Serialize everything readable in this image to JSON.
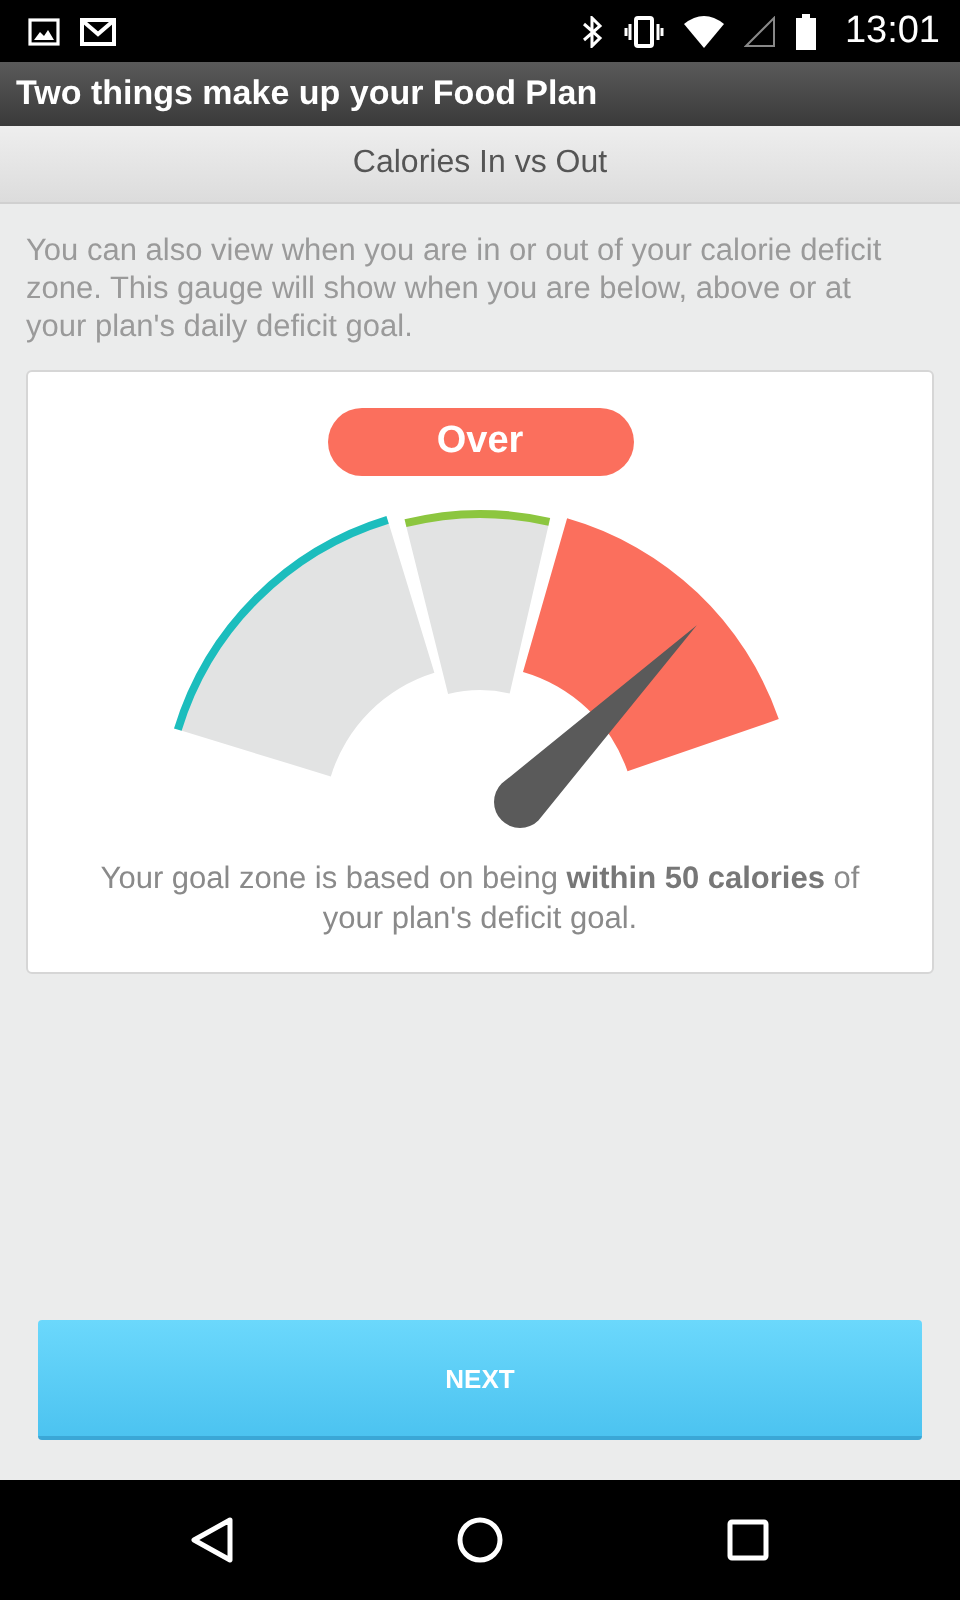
{
  "status_bar": {
    "time": "13:01"
  },
  "header": {
    "title": "Two things make up your Food Plan"
  },
  "subheader": {
    "title": "Calories In vs Out"
  },
  "intro": "You can also view when you are in or out of your calorie deficit zone. This gauge will show when you are below, above or at your plan's daily deficit goal.",
  "gauge": {
    "status": "Over",
    "segments": [
      {
        "color": "#1cbdbd",
        "selected": false
      },
      {
        "color": "#8cc63f",
        "selected": false
      },
      {
        "color": "#fb6f5d",
        "selected": true
      }
    ]
  },
  "goal_text": "Your goal zone is based on being **within 50 calories** of your plan's deficit goal.",
  "button": "NEXT"
}
